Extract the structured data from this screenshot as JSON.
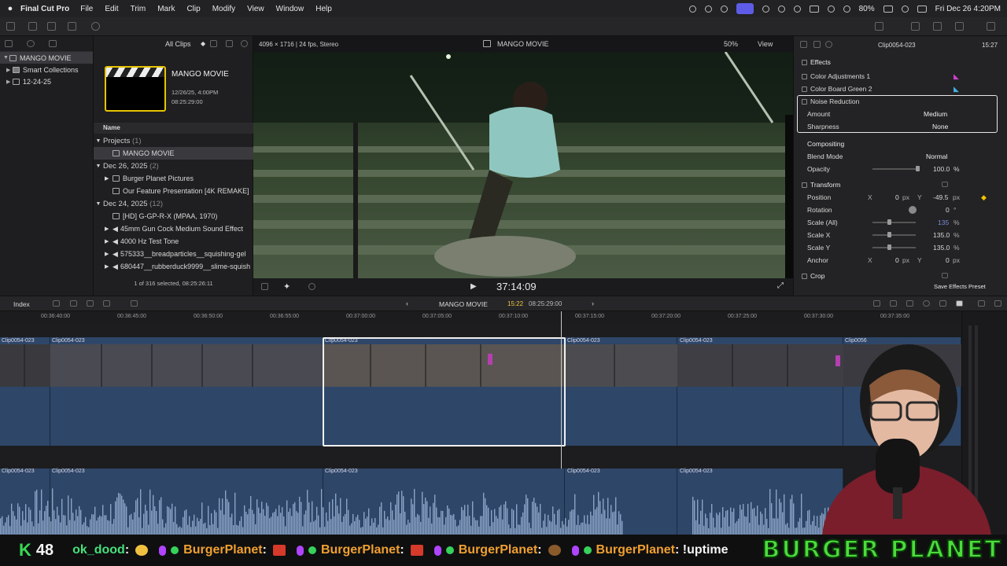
{
  "menubar": {
    "app": "Final Cut Pro",
    "items": [
      "File",
      "Edit",
      "Trim",
      "Mark",
      "Clip",
      "Modify",
      "View",
      "Window",
      "Help"
    ],
    "battery": "80%",
    "datetime": "Fri Dec 26  4:20PM"
  },
  "library": {
    "name": "MANGO MOVIE",
    "items": [
      {
        "label": "MANGO MOVIE"
      },
      {
        "label": "Smart Collections"
      },
      {
        "label": "12-24-25"
      }
    ]
  },
  "browser": {
    "filter": "All Clips",
    "project_title": "MANGO MOVIE",
    "project_date": "12/26/25, 4:00PM",
    "project_duration": "08:25:29:00",
    "column_name": "Name",
    "groups": [
      {
        "label": "Projects",
        "count": "(1)"
      },
      {
        "label": "Dec 26, 2025",
        "count": "(2)"
      },
      {
        "label": "Dec 24, 2025",
        "count": "(12)"
      }
    ],
    "rows": [
      "MANGO MOVIE",
      "Burger Planet Pictures",
      "Our Feature Presentation [4K REMAKE]",
      "[HD] G-GP-R-X (MPAA, 1970)",
      "45mm Gun Cock Medium Sound Effect",
      "4000 Hz Test Tone",
      "575333__breadparticles__squishing-gel",
      "680447__rubberduck9999__slime-squish"
    ],
    "status": "1 of 316 selected, 08:25:26:11"
  },
  "viewer": {
    "format": "4096 × 1716 | 24 fps, Stereo",
    "title": "MANGO MOVIE",
    "zoom": "50%",
    "view_label": "View",
    "timecode": "37:14:09"
  },
  "inspector": {
    "clip_name": "Clip0054-023",
    "duration": "15:27",
    "effects_title": "Effects",
    "effects": [
      "Color Adjustments 1",
      "Color Board Green 2",
      "Noise Reduction"
    ],
    "amount_label": "Amount",
    "amount_value": "Medium",
    "sharpness_label": "Sharpness",
    "sharpness_value": "None",
    "compositing_title": "Compositing",
    "blend_label": "Blend Mode",
    "blend_value": "Normal",
    "opacity_label": "Opacity",
    "opacity_value": "100.0",
    "opacity_unit": "%",
    "transform_title": "Transform",
    "position_label": "Position",
    "x_label": "X",
    "y_label": "Y",
    "position_x": "0",
    "position_y": "-49.5",
    "px_unit": "px",
    "rotation_label": "Rotation",
    "rotation_value": "0",
    "rotation_unit": "°",
    "scale_all_label": "Scale (All)",
    "scale_all_value": "135",
    "scale_x_label": "Scale X",
    "scale_x_value": "135.0",
    "scale_y_label": "Scale Y",
    "scale_y_value": "135.0",
    "anchor_label": "Anchor",
    "anchor_x": "0",
    "anchor_y": "0",
    "crop_title": "Crop",
    "save_preset": "Save Effects Preset",
    "opacity_level": 1.0,
    "scale_level": 0.35
  },
  "timeline": {
    "index_label": "Index",
    "project": "MANGO MOVIE",
    "position": "15:22",
    "total": "08:25:29:00",
    "ruler": [
      "00:36:40:00",
      "00:36:45:00",
      "00:36:50:00",
      "00:36:55:00",
      "00:37:00:00",
      "00:37:05:00",
      "00:37:10:00",
      "00:37:15:00",
      "00:37:20:00",
      "00:37:25:00",
      "00:37:30:00",
      "00:37:35:00"
    ],
    "video_clips": [
      "Clip0054-023",
      "Clip0054-023",
      "Clip0054-023",
      "Clip0054-023",
      "Clip0054-023",
      "Clip0056"
    ],
    "audio_clips": [
      "Clip0054-023",
      "Clip0054-023",
      "Clip0054-023",
      "Clip0054-023",
      "Clip0054-023"
    ]
  },
  "ticker": {
    "k_label": "K",
    "k_count": "48",
    "entries": [
      {
        "user": "ok_dood",
        "text": ":"
      },
      {
        "user": "BurgerPlanet",
        "text": ":"
      },
      {
        "user": "BurgerPlanet",
        "text": ":"
      },
      {
        "user": "BurgerPlanet",
        "text": ":"
      },
      {
        "user": "BurgerPlanet",
        "text": ": !uptime"
      }
    ],
    "logo": "BURGER PLANET"
  },
  "colors": {
    "accent": "#5e5ce6",
    "selection_yellow": "#e8c400",
    "clip_blue": "#2e4668",
    "keyframe": "#f5c400",
    "ticker_green": "#36d25a"
  }
}
